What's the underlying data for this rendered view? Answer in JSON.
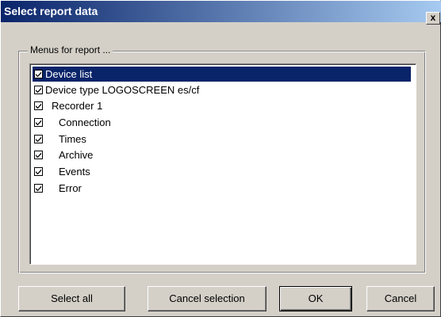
{
  "window": {
    "title": "Select report data",
    "close_label": "x"
  },
  "group": {
    "legend": "Menus for report ..."
  },
  "list": {
    "items": [
      {
        "label": "Device list",
        "checked": true,
        "selected": true
      },
      {
        "label": "Device type LOGOSCREEN es/cf",
        "checked": true,
        "selected": false
      },
      {
        "label": "Recorder 1",
        "checked": true,
        "selected": false
      },
      {
        "label": "Connection",
        "checked": true,
        "selected": false
      },
      {
        "label": "Times",
        "checked": true,
        "selected": false
      },
      {
        "label": "Archive",
        "checked": true,
        "selected": false
      },
      {
        "label": "Events",
        "checked": true,
        "selected": false
      },
      {
        "label": "Error",
        "checked": true,
        "selected": false
      }
    ]
  },
  "buttons": {
    "select_all": "Select all",
    "cancel_selection": "Cancel selection",
    "ok": "OK",
    "cancel": "Cancel"
  },
  "colors": {
    "titlebar_start": "#0a246a",
    "titlebar_end": "#a6caf0",
    "selection": "#0a246a",
    "face": "#d4d0c8"
  }
}
